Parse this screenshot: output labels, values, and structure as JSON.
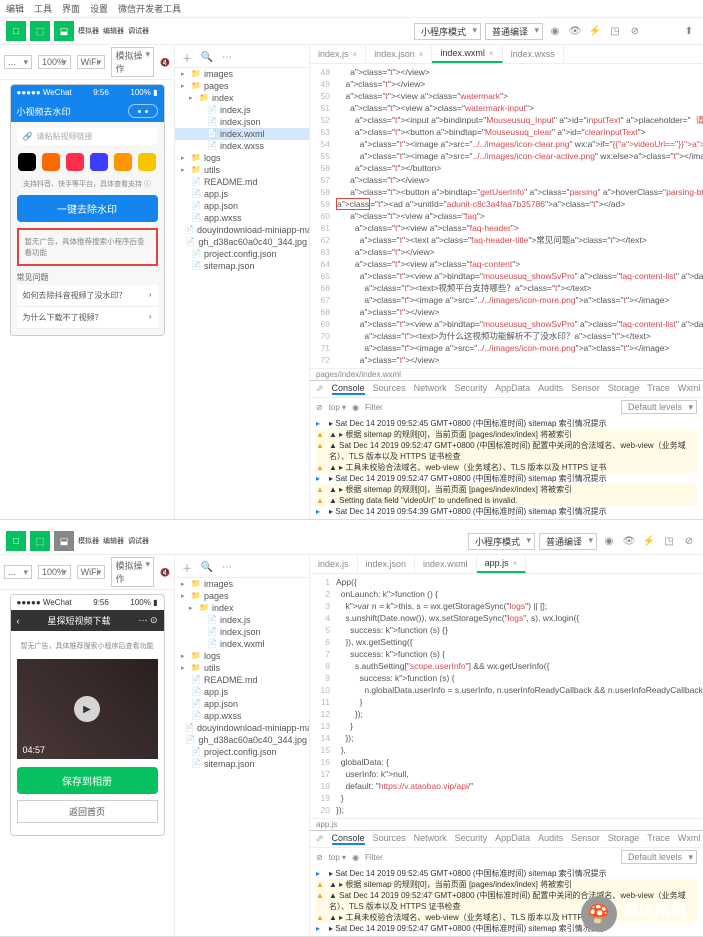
{
  "top": {
    "menu": [
      "编辑",
      "工具",
      "界面",
      "设置",
      "微信开发者工具"
    ],
    "tb": {
      "b1": "模拟器",
      "b2": "编辑器",
      "b3": "调试器",
      "mode": "小程序模式",
      "compile": "普通编译",
      "a1": "编译",
      "a2": "预览",
      "a3": "真机调试",
      "a4": "切后台",
      "a5": "清缓存"
    },
    "ph_tb": {
      "pct": "100%",
      "net": "WiFi",
      "sim": "模拟操作"
    },
    "phone": {
      "carrier": "WeChat",
      "time": "9:56",
      "title": "小视频去水印",
      "search_ph": "请粘贴视频链接",
      "hint": "支持抖音、快手等平台，具体查看支持",
      "btn": "一键去除水印",
      "redbx": "暂无广告，具体推荐搜索小程序后查看功能",
      "faq_h": "常见问题",
      "faq1": "如何去除抖音视频了没水印？",
      "faq2": "为什么下载不了视频？"
    },
    "tree": [
      "images",
      "pages",
      "index",
      "index.js",
      "index.json",
      "index.wxml",
      "index.wxss",
      "logs",
      "utils",
      "README.md",
      "app.js",
      "app.json",
      "app.wxss",
      "douyindownload-miniapp-master.zip",
      "gh_d38ac60a0c40_344.jpg",
      "project.config.json",
      "sitemap.json"
    ],
    "tabs": [
      "index.js",
      "index.json",
      "index.wxml",
      "index.wxss"
    ],
    "code": [
      [
        48,
        "      </view>"
      ],
      [
        49,
        "    </view>"
      ],
      [
        50,
        "    <view class=\"watermark\">"
      ],
      [
        51,
        "      <view class=\"watermark-input\">"
      ],
      [
        52,
        "        <input bindinput=\"Mouseusuq_Input\" id=\"inputText\" placeholder=\"  请复制视频链接，粘贴到这里\" type=\"text\""
      ],
      [
        53,
        "        <button bindtap=\"Mouseusuq_clear\" id=\"clearInputText\">"
      ],
      [
        54,
        "          <image src=\"../../images/icon-clear.png\" wx:if=\"{{videoUrl==''}}\"></image>"
      ],
      [
        55,
        "          <image src=\"../../images/icon-clear-active.png\" wx:else></image>"
      ],
      [
        56,
        "        </button>"
      ],
      [
        57,
        "      </view>"
      ],
      [
        58,
        "      <button bindtap=\"getUserInfo\" class=\"parsing\" hoverClass=\"parsing-btn-hover\" openType=\"getUserI"
      ],
      [
        59,
        "<ad unitId=\"adunit-c8c3a4faa7b35786\"></ad>"
      ],
      [
        60,
        "      <view class=\"faq\">"
      ],
      [
        61,
        "        <view class=\"faq-header\">"
      ],
      [
        62,
        "          <text class=\"faq-header-title\">常见问题</text>"
      ],
      [
        63,
        "        </view>"
      ],
      [
        64,
        "        <view class=\"faq-content\">"
      ],
      [
        65,
        "          <view bindtap=\"mouseusuq_showSvPro\" class=\"faq-content-list\" data-index=\"0\">"
      ],
      [
        66,
        "            <text>视频平台支持哪些？</text>"
      ],
      [
        67,
        "            <image src=\"../../images/icon-more.png\"></image>"
      ],
      [
        68,
        "          </view>"
      ],
      [
        69,
        "          <view bindtap=\"mouseusuq_showSvPro\" class=\"faq-content-list\" data-index=\"1\">"
      ],
      [
        70,
        "            <text>为什么这视频功能解析不了没水印？</text>"
      ],
      [
        71,
        "            <image src=\"../../images/icon-more.png\"></image>"
      ],
      [
        72,
        "          </view>"
      ]
    ],
    "crumb": "pages/index/index.wxml",
    "cons_tabs": [
      "Console",
      "Sources",
      "Network",
      "Security",
      "AppData",
      "Audits",
      "Sensor",
      "Storage",
      "Trace",
      "Wxml"
    ],
    "filter": "Default levels",
    "console": [
      [
        "i",
        "▸ Sat Dec 14 2019 09:52:45 GMT+0800 (中国标准时间) sitemap 索引情况提示"
      ],
      [
        "w",
        "▲ ▸ 根据 sitemap 的规则[0]，当前页面 [pages/index/index] 将被索引"
      ],
      [
        "w",
        "▲ Sat Dec 14 2019 09:52:47 GMT+0800 (中国标准时间) 配置中关闭的合法域名、web-view（业务域名）、TLS 版本以及 HTTPS 证书检查"
      ],
      [
        "w",
        "▲ ▸ 工具未校验合法域名、web-view（业务域名）、TLS 版本以及 HTTPS 证书"
      ],
      [
        "i",
        "▸ Sat Dec 14 2019 09:52:47 GMT+0800 (中国标准时间) sitemap 索引情况提示"
      ],
      [
        "w",
        "▲ ▸ 根据 sitemap 的规则[0]，当前页面 [pages/index/index] 将被索引"
      ],
      [
        "w",
        "▲ Setting data field \"videoUrl\" to undefined is invalid."
      ],
      [
        "i",
        "▸ Sat Dec 14 2019 09:54:39 GMT+0800 (中国标准时间) sitemap 索引情况提示"
      ]
    ]
  },
  "bot": {
    "tb": {
      "b1": "模拟器",
      "b2": "编辑器",
      "b3": "调试器"
    },
    "phone": {
      "carrier": "WeChat",
      "time": "9:56",
      "title": "星探短视频下载",
      "hint": "暂无广告，具体推荐搜索小程序后查看功能",
      "vtime": "04:57",
      "btn_save": "保存到相册",
      "btn_home": "返回首页"
    },
    "tree": [
      "images",
      "pages",
      "index",
      "index.js",
      "index.json",
      "index.wxml",
      "logs",
      "utils",
      "README.md",
      "app.js",
      "app.json",
      "app.wxss",
      "douyindownload-miniapp-master.zip",
      "gh_d38ac60a0c40_344.jpg",
      "project.config.json",
      "sitemap.json"
    ],
    "tabs": [
      "index.js",
      "index.json",
      "index.wxml",
      "app.js"
    ],
    "code": [
      [
        1,
        "App({"
      ],
      [
        2,
        "  onLaunch: function () {"
      ],
      [
        3,
        "    var n = this, s = wx.getStorageSync(\"logs\") || [];"
      ],
      [
        4,
        "    s.unshift(Date.now()), wx.setStorageSync(\"logs\", s), wx.login({"
      ],
      [
        5,
        "      success: function (s) {}"
      ],
      [
        6,
        "    }), wx.getSetting({"
      ],
      [
        7,
        "      success: function (s) {"
      ],
      [
        8,
        "        s.authSetting[\"scope.userInfo\"] && wx.getUserInfo({"
      ],
      [
        9,
        "          success: function (s) {"
      ],
      [
        10,
        "            n.globalData.userInfo = s.userInfo, n.userInfoReadyCallback && n.userInfoReadyCallback(s);"
      ],
      [
        11,
        "          }"
      ],
      [
        12,
        "        });"
      ],
      [
        13,
        "      }"
      ],
      [
        14,
        "    });"
      ],
      [
        15,
        "  },"
      ],
      [
        16,
        "  globalData: {"
      ],
      [
        17,
        "    userInfo: null,"
      ],
      [
        18,
        "    default: \"https://v.ataobao.vip/api/\""
      ],
      [
        19,
        "  }"
      ],
      [
        20,
        "});"
      ]
    ],
    "crumb": "app.js",
    "console": [
      [
        "i",
        "▸ Sat Dec 14 2019 09:52:45 GMT+0800 (中国标准时间) sitemap 索引情况提示"
      ],
      [
        "w",
        "▲ ▸ 根据 sitemap 的规则[0]，当前页面 [pages/index/index] 将被索引"
      ],
      [
        "w",
        "▲ Sat Dec 14 2019 09:52:47 GMT+0800 (中国标准时间) 配置中关闭的合法域名、web-view（业务域名）、TLS 版本以及 HTTPS 证书检查"
      ],
      [
        "w",
        "▲ ▸ 工具未校验合法域名、web-view（业务域名）、TLS 版本以及 HTTPS 证书"
      ],
      [
        "i",
        "▸ Sat Dec 14 2019 09:52:47 GMT+0800 (中国标准时间) sitemap 索引情况提示"
      ]
    ]
  },
  "wm": {
    "label": "黑区网络",
    "url": "www.heiqu.com"
  }
}
